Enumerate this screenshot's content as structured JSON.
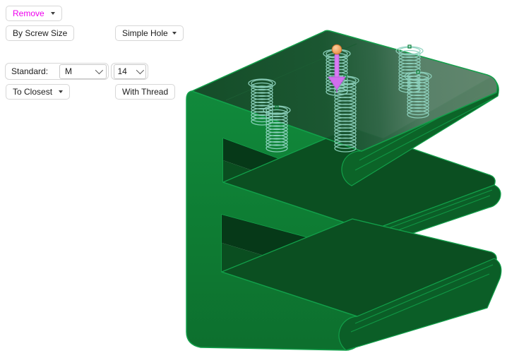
{
  "panel": {
    "remove": "Remove",
    "by_screw_size": "By Screw Size",
    "simple_hole": "Simple Hole",
    "standard_label": "Standard:",
    "standard_value": "M",
    "size_value": "14",
    "to_closest": "To Closest",
    "with_thread": "With Thread"
  },
  "icons": {
    "dropdown_caret": "triangle-down",
    "combo_chevron": "chevron-down"
  },
  "viewport": {
    "thread_helices": 6,
    "manipulator_handle": "orange-sphere",
    "manipulator_arrow": "magenta-down-arrow"
  },
  "colors": {
    "remove_text": "#EE00EE",
    "button_border": "#D7D7D7",
    "model_bright_green": "#0F8038",
    "model_dark_green": "#0A4C1F",
    "thread_teal": "#8FD3BF",
    "handle_orange": "#F0A360",
    "arrow_magenta": "#D97BF2"
  }
}
